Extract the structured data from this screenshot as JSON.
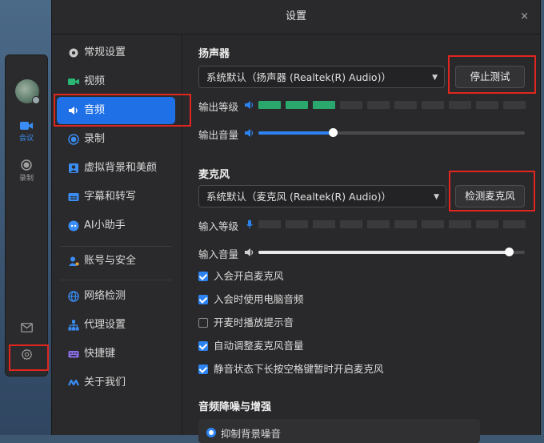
{
  "window": {
    "title": "设置",
    "close": "×"
  },
  "rail": {
    "meeting_label": "会议",
    "record_label": "录制"
  },
  "nav": {
    "items": [
      {
        "label": "常规设置"
      },
      {
        "label": "视频"
      },
      {
        "label": "音频"
      },
      {
        "label": "录制"
      },
      {
        "label": "虚拟背景和美颜"
      },
      {
        "label": "字幕和转写"
      },
      {
        "label": "AI小助手"
      },
      {
        "label": "账号与安全"
      },
      {
        "label": "网络检测"
      },
      {
        "label": "代理设置"
      },
      {
        "label": "快捷键"
      },
      {
        "label": "关于我们"
      }
    ],
    "active_index": 2
  },
  "speaker": {
    "title": "扬声器",
    "device": "系统默认（扬声器 (Realtek(R) Audio)）",
    "test_button": "停止测试",
    "level_label": "输出等级",
    "level_segments_on": 3,
    "level_segments_total": 10,
    "volume_label": "输出音量",
    "volume": 0.28
  },
  "mic": {
    "title": "麦克风",
    "device": "系统默认（麦克风 (Realtek(R) Audio)）",
    "test_button": "检测麦克风",
    "level_label": "输入等级",
    "level_segments_on": 0,
    "level_segments_total": 10,
    "volume_label": "输入音量",
    "volume": 0.94
  },
  "options": [
    {
      "label": "入会开启麦克风",
      "checked": true
    },
    {
      "label": "入会时使用电脑音频",
      "checked": true
    },
    {
      "label": "开麦时播放提示音",
      "checked": false
    },
    {
      "label": "自动调整麦克风音量",
      "checked": true
    },
    {
      "label": "静音状态下长按空格键暂时开启麦克风",
      "checked": true
    }
  ],
  "enhance": {
    "title": "音频降噪与增强",
    "option": "抑制背景噪音"
  },
  "colors": {
    "accent": "#1f6fe6",
    "level_on": "#2aa76c",
    "highlight": "#e0261f"
  }
}
